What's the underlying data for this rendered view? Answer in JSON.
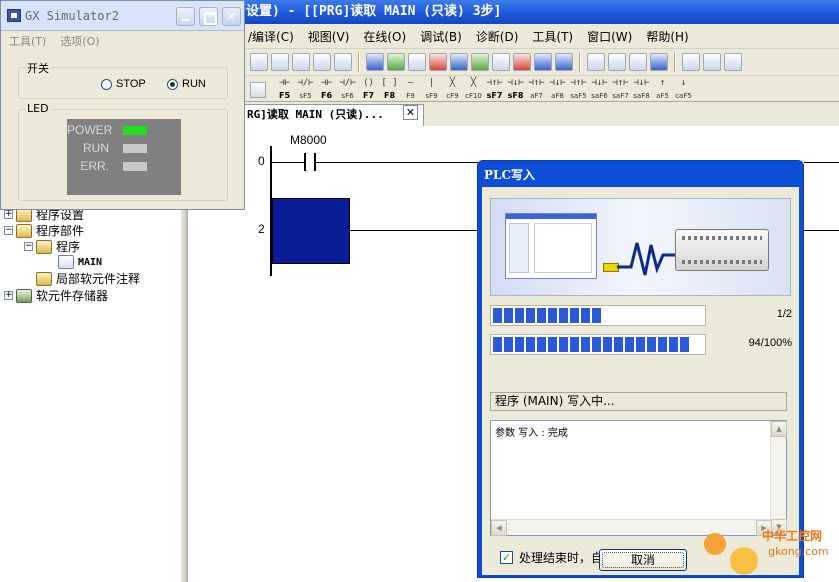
{
  "main_window": {
    "title": "设置) - [[PRG]读取 MAIN (只读) 3步]",
    "menu": [
      "/编译(C)",
      "视图(V)",
      "在线(O)",
      "调试(B)",
      "诊断(D)",
      "工具(T)",
      "窗口(W)",
      "帮助(H)"
    ],
    "function_keys": [
      {
        "sym": "⊣⊢",
        "label": "F5",
        "bold": true
      },
      {
        "sym": "⊣/⊢",
        "label": "sF5",
        "bold": false
      },
      {
        "sym": "⊣⊢",
        "label": "F6",
        "bold": true
      },
      {
        "sym": "⊣/⊢",
        "label": "sF6",
        "bold": false
      },
      {
        "sym": "⟨⟩",
        "label": "F7",
        "bold": true
      },
      {
        "sym": "[ ]",
        "label": "F8",
        "bold": true
      },
      {
        "sym": "—",
        "label": "F9",
        "bold": false
      },
      {
        "sym": "|",
        "label": "sF9",
        "bold": false
      },
      {
        "sym": "╳",
        "label": "cF9",
        "bold": false
      },
      {
        "sym": "╳",
        "label": "cF10",
        "bold": false
      },
      {
        "sym": "⊣↑⊢",
        "label": "sF7",
        "bold": true
      },
      {
        "sym": "⊣↓⊢",
        "label": "sF8",
        "bold": true
      },
      {
        "sym": "⊣↑⊢",
        "label": "aF7",
        "bold": false
      },
      {
        "sym": "⊣↓⊢",
        "label": "aF8",
        "bold": false
      },
      {
        "sym": "⊣↑⊢",
        "label": "saF5",
        "bold": false
      },
      {
        "sym": "⊣↓⊢",
        "label": "saF6",
        "bold": false
      },
      {
        "sym": "⊣↑⊢",
        "label": "saF7",
        "bold": false
      },
      {
        "sym": "⊣↓⊢",
        "label": "saF8",
        "bold": false
      },
      {
        "sym": "↑",
        "label": "aF5",
        "bold": false
      },
      {
        "sym": "↓",
        "label": "caF5",
        "bold": false
      }
    ],
    "tab_label": "RG]读取 MAIN (只读)...",
    "tab_close": "✕"
  },
  "ladder": {
    "step0": "0",
    "step2": "2",
    "contact_device": "M8000"
  },
  "tree": {
    "items": [
      {
        "label": "程序设置"
      },
      {
        "label": "程序部件"
      },
      {
        "label": "程序"
      },
      {
        "label": "MAIN"
      },
      {
        "label": "局部软元件注释"
      },
      {
        "label": "软元件存储器"
      }
    ]
  },
  "simulator": {
    "title": "GX Simulator2",
    "menu": [
      "工具(T)",
      "选项(O)"
    ],
    "switch_group": "开关",
    "stop_label": "STOP",
    "run_label": "RUN",
    "selected": "RUN",
    "led_group": "LED",
    "leds": [
      {
        "label": "POWER",
        "color": "#22dd22"
      },
      {
        "label": "RUN",
        "color": "#c8c8c8"
      },
      {
        "label": "ERR.",
        "color": "#c8c8c8"
      }
    ]
  },
  "dialog": {
    "title": "PLC写入",
    "step_progress": {
      "text": "1/2",
      "fraction": 0.5
    },
    "total_progress": {
      "text": "94/100%",
      "fraction": 0.94
    },
    "status": "程序 (MAIN) 写入中...",
    "log": "参数  写入 :  完成",
    "auto_close_label": "处理结束时，自动关闭窗口。",
    "auto_close_checked": true,
    "cancel_label": "取消"
  },
  "watermark": {
    "line1": "中华工控网",
    "line2": "gkong.com"
  },
  "colors": {
    "title_blue": "#1a56d8",
    "progress_blue": "#2a5ad7",
    "led_on": "#22dd22",
    "cursor_block": "#0a1d99"
  }
}
